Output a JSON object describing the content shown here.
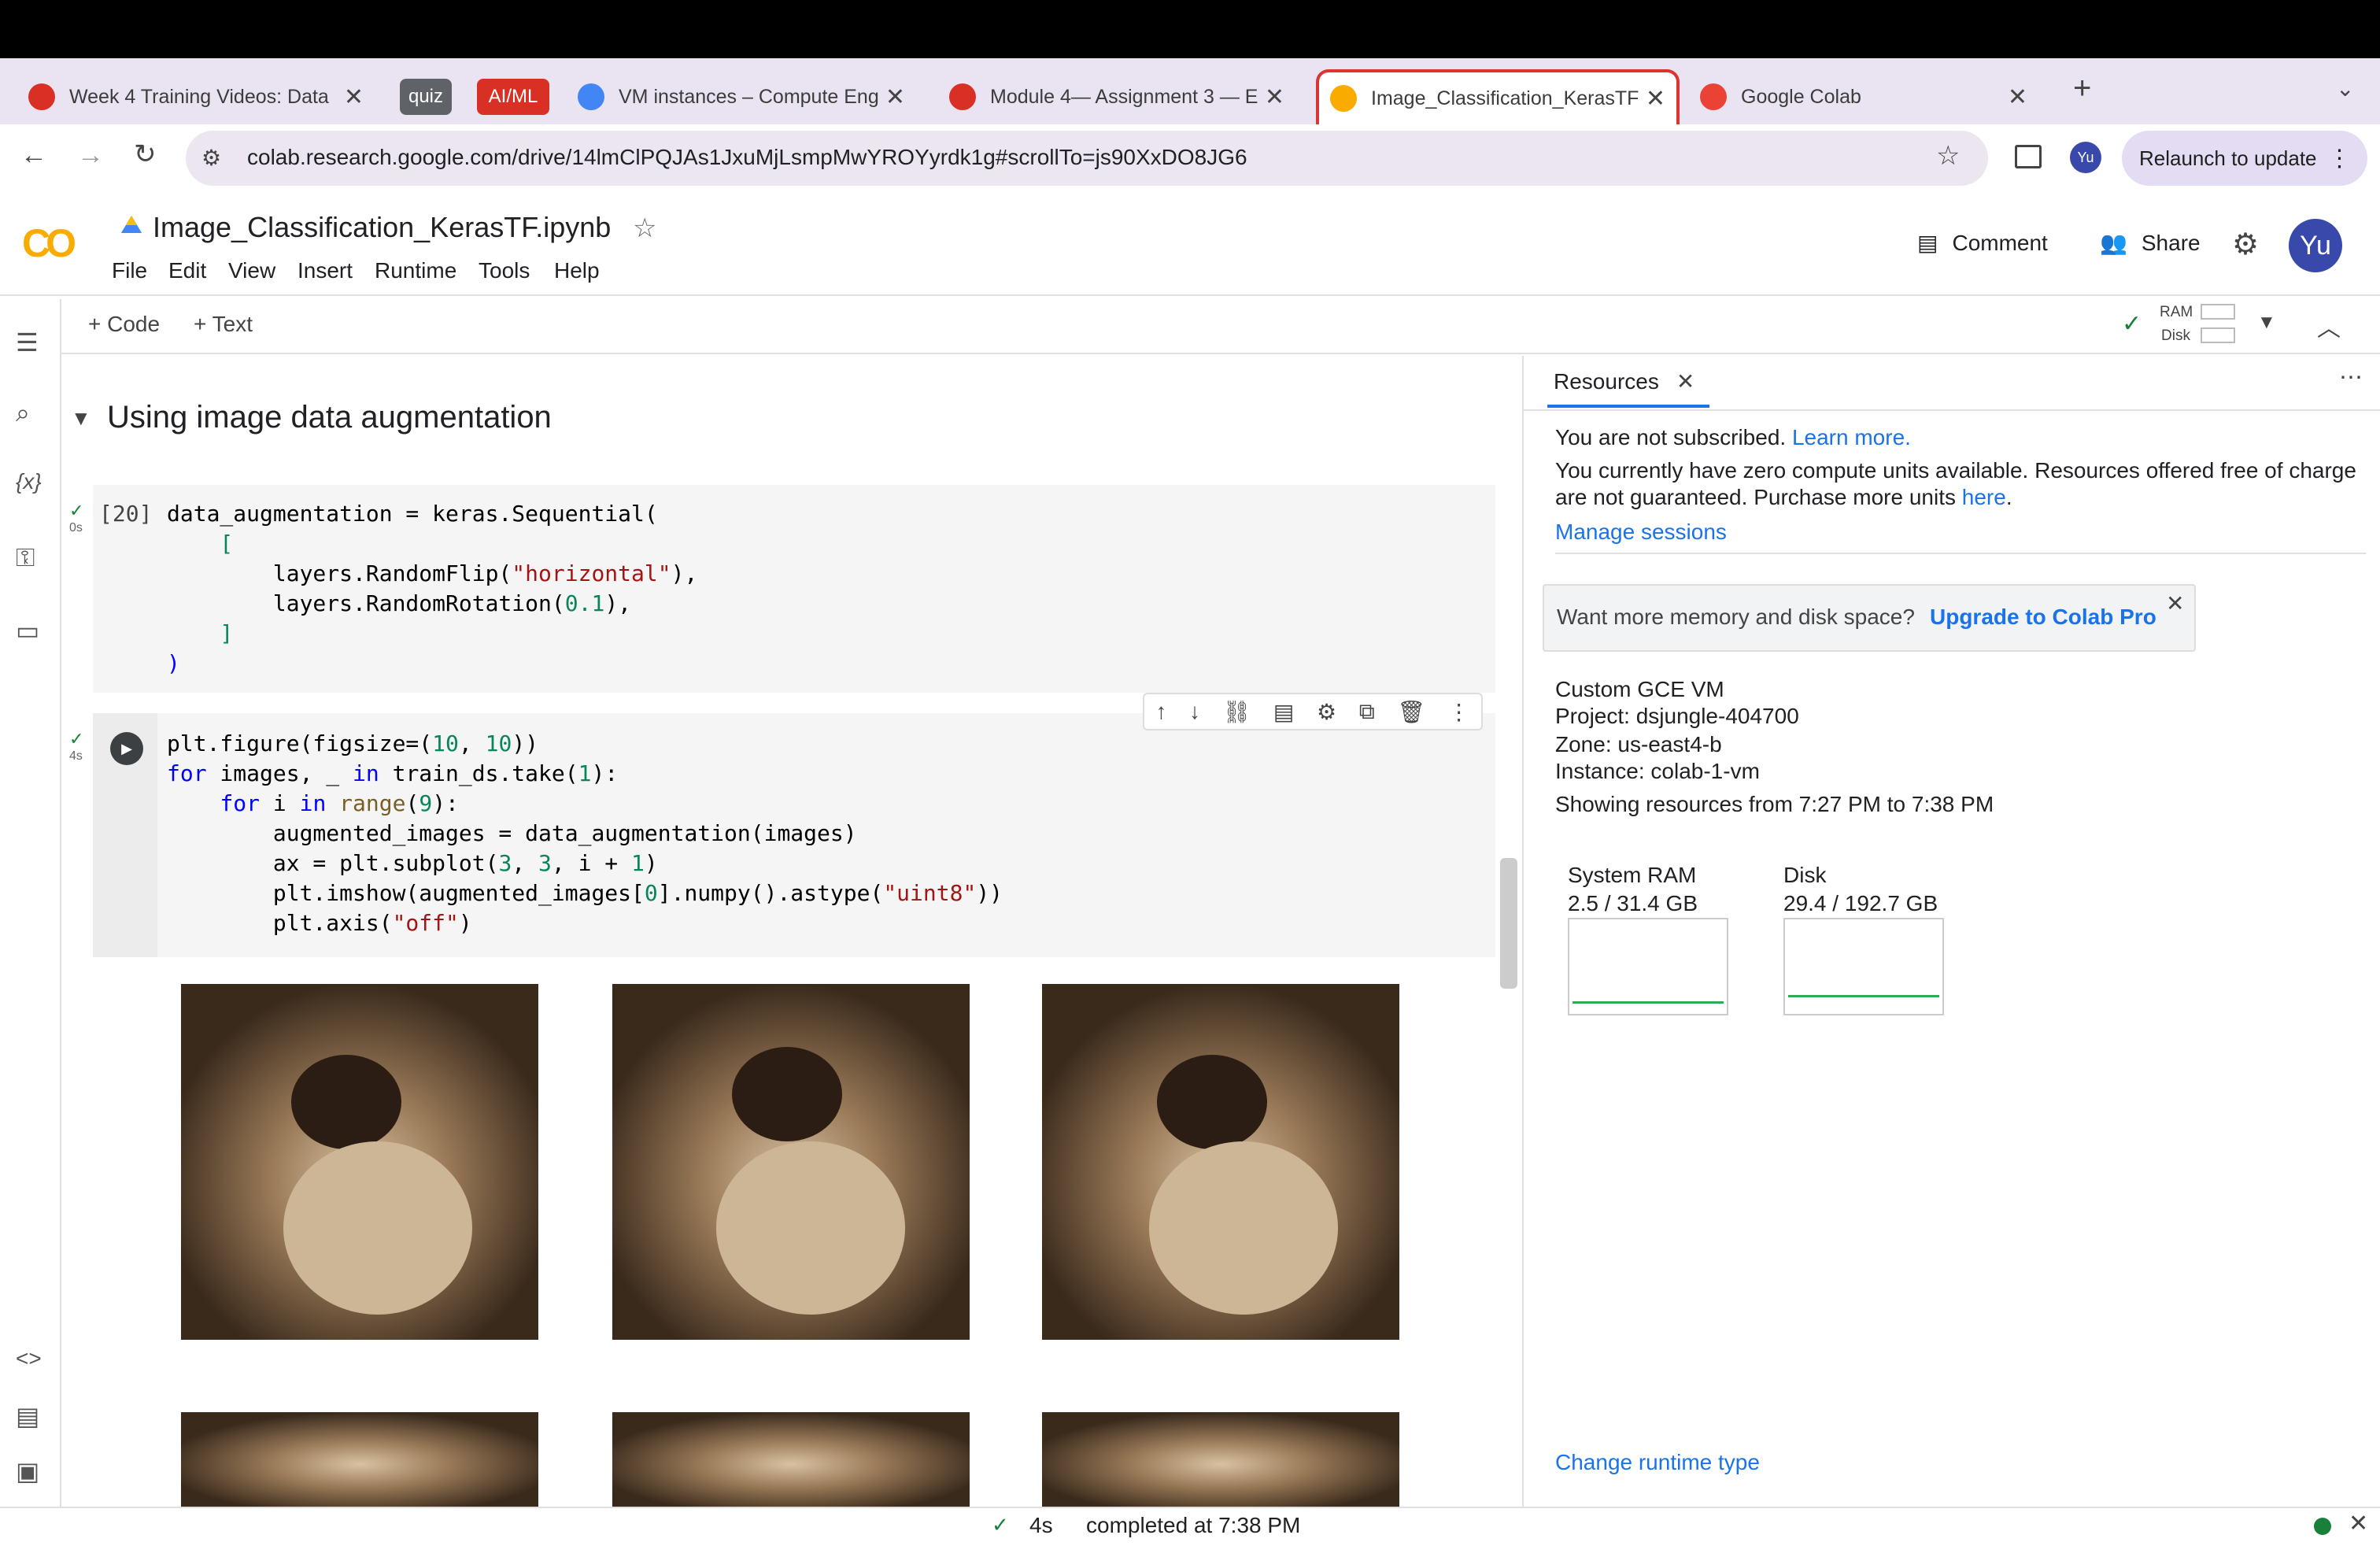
{
  "browser": {
    "tabs": [
      {
        "title": "Week 4 Training Videos: Data",
        "fav_color": "#d93025"
      },
      {
        "title": "VM instances – Compute Eng",
        "fav_color": "#4285f4"
      },
      {
        "title": "Module 4— Assignment 3 — E",
        "fav_color": "#d93025"
      },
      {
        "title": "Image_Classification_KerasTF",
        "fav_color": "#f9ab00"
      },
      {
        "title": "Google Colab",
        "fav_color": "#ea4335"
      }
    ],
    "tab_groups": [
      {
        "label": "quiz",
        "color": "#5f6368"
      },
      {
        "label": "AI/ML",
        "color": "#d93025"
      }
    ],
    "new_tab": "+",
    "url": "colab.research.google.com/drive/14lmClPQJAs1JxuMjLsmpMwYROYyrdk1g#scrollTo=js90XxDO8JG6",
    "profile_initials": "Yu",
    "relaunch_label": "Relaunch to update"
  },
  "colab": {
    "logo": "CO",
    "notebook_title": "Image_Classification_KerasTF.ipynb",
    "menu": [
      "File",
      "Edit",
      "View",
      "Insert",
      "Runtime",
      "Tools",
      "Help"
    ],
    "comment_label": "Comment",
    "share_label": "Share",
    "avatar": "Yu",
    "toolbar": {
      "code_label": "+ Code",
      "text_label": "+ Text",
      "ram_label": "RAM",
      "disk_label": "Disk"
    }
  },
  "notebook": {
    "section_title": "Using image data augmentation",
    "cell1": {
      "exec_count": "[20]",
      "time": "0s",
      "lines": [
        "data_augmentation = keras.Sequential(",
        "    [",
        "        layers.RandomFlip(\"horizontal\"),",
        "        layers.RandomRotation(0.1),",
        "    ]",
        ")"
      ]
    },
    "cell2": {
      "time": "4s",
      "lines": [
        "plt.figure(figsize=(10, 10))",
        "for images, _ in train_ds.take(1):",
        "    for i in range(9):",
        "        augmented_images = data_augmentation(images)",
        "        ax = plt.subplot(3, 3, i + 1)",
        "        plt.imshow(augmented_images[0].numpy().astype(\"uint8\"))",
        "        plt.axis(\"off\")"
      ]
    }
  },
  "resources": {
    "tab_label": "Resources",
    "not_subscribed": "You are not subscribed.",
    "learn_more": "Learn more.",
    "compute_line1": "You currently have zero compute units available. Resources offered free of charge",
    "compute_line2": "are not guaranteed. Purchase more units",
    "here": "here",
    "manage_sessions": "Manage sessions",
    "promo_text": "Want more memory and disk space?",
    "promo_link": "Upgrade to Colab Pro",
    "vm_type": "Custom GCE VM",
    "project": "Project: dsjungle-404700",
    "zone": "Zone: us-east4-b",
    "instance": "Instance: colab-1-vm",
    "showing": "Showing resources from 7:27 PM to 7:38 PM",
    "ram_title": "System RAM",
    "ram_value": "2.5 / 31.4 GB",
    "ram_fraction": 0.08,
    "disk_title": "Disk",
    "disk_value": "29.4 / 192.7 GB",
    "disk_fraction": 0.15,
    "change_runtime": "Change runtime type"
  },
  "status": {
    "duration": "4s",
    "completed": "completed at 7:38 PM"
  }
}
